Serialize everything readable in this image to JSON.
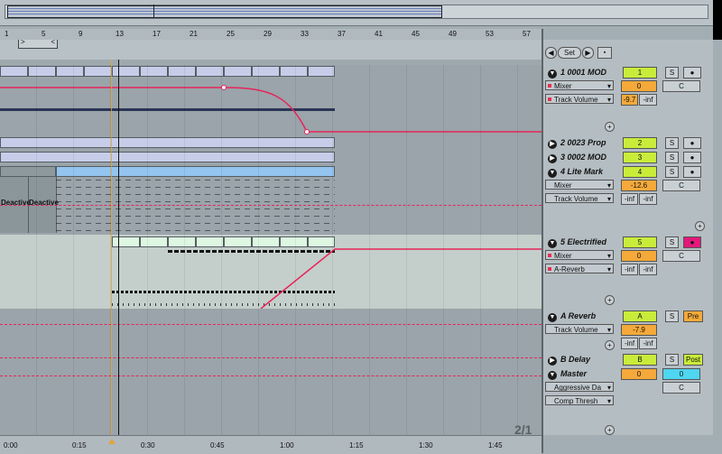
{
  "ruler": {
    "bars": [
      "1",
      "5",
      "9",
      "13",
      "17",
      "21",
      "25",
      "29",
      "33",
      "37",
      "41",
      "45",
      "49",
      "53",
      "57"
    ]
  },
  "timeline": {
    "times": [
      "0:00",
      "0:15",
      "0:30",
      "0:45",
      "1:00",
      "1:15",
      "1:30",
      "1:45"
    ]
  },
  "header": {
    "set_label": "Set",
    "prev_icon": "◀",
    "next_icon": "▶"
  },
  "loop": {
    "left_glyph": ">",
    "right_glyph": "<"
  },
  "zoom_ratio": "2/1",
  "deactivated_label": "Deactive",
  "tracks": [
    {
      "name": "1 0001 MOD",
      "number": "1",
      "solo": "S",
      "device": "Mixer",
      "param": "Track Volume",
      "value": "0",
      "value2": "-9.7",
      "value3": "-inf",
      "c": "C"
    },
    {
      "name": "2 0023 Prop",
      "number": "2",
      "solo": "S"
    },
    {
      "name": "3 0002 MOD",
      "number": "3",
      "solo": "S"
    },
    {
      "name": "4 Lite Mark",
      "number": "4",
      "solo": "S",
      "device": "Mixer",
      "param": "Track Volume",
      "value": "-12.6",
      "inf1": "-inf",
      "inf2": "-inf",
      "c": "C"
    },
    {
      "name": "5 Electrified",
      "number": "5",
      "solo": "S",
      "device": "Mixer",
      "param": "A-Reverb",
      "value": "0",
      "inf1": "-inf",
      "inf2": "-inf",
      "c": "C"
    }
  ],
  "returns": [
    {
      "name": "A Reverb",
      "letter": "A",
      "solo": "S",
      "mode": "Pre",
      "param": "Track Volume",
      "value": "-7.9",
      "inf1": "-inf",
      "inf2": "-inf"
    },
    {
      "name": "B Delay",
      "letter": "B",
      "solo": "S",
      "mode": "Post"
    }
  ],
  "master": {
    "name": "Master",
    "device": "Aggressive Da",
    "param": "Comp Thresh",
    "value": "0",
    "value2": "0",
    "c": "C"
  },
  "colors": {
    "track_green": "#c9ec3a",
    "orange": "#f4a93a",
    "pink": "#e2187a",
    "cyan": "#4fd6f0",
    "automation": "#e8245a"
  }
}
